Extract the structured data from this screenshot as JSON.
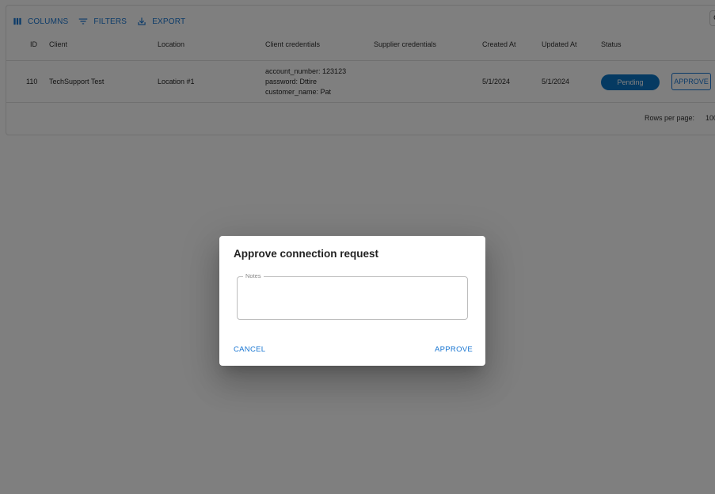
{
  "toolbar": {
    "columns_label": "COLUMNS",
    "filters_label": "FILTERS",
    "export_label": "EXPORT",
    "search_icon": "search-icon"
  },
  "table": {
    "headers": {
      "id": "ID",
      "client": "Client",
      "location": "Location",
      "client_credentials": "Client credentials",
      "supplier_credentials": "Supplier credentials",
      "created_at": "Created At",
      "updated_at": "Updated At",
      "status": "Status"
    },
    "rows": [
      {
        "id": "110",
        "client": "TechSupport Test",
        "location": "Location #1",
        "client_credentials": [
          "account_number: 123123",
          "password: Dttire",
          "customer_name: Pat"
        ],
        "supplier_credentials": "",
        "created_at": "5/1/2024",
        "updated_at": "5/1/2024",
        "status": "Pending",
        "action_label": "APPROVE"
      }
    ]
  },
  "footer": {
    "rows_per_page_label": "Rows per page:",
    "rows_per_page_value": "100"
  },
  "dialog": {
    "title": "Approve connection request",
    "notes_label": "Notes",
    "notes_value": "",
    "cancel_label": "CANCEL",
    "approve_label": "APPROVE"
  },
  "colors": {
    "accent": "#1976d2",
    "status_chip": "#0b74c5",
    "backdrop": "rgba(0,0,0,0.5)"
  }
}
